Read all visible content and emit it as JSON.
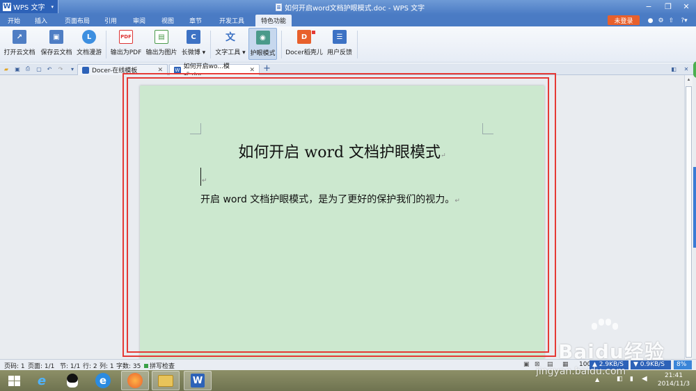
{
  "app": {
    "name": "WPS 文字",
    "window_title": "如何开启word文档护眼模式.doc - WPS 文字"
  },
  "menu": {
    "tabs": [
      "开始",
      "插入",
      "页面布局",
      "引用",
      "审阅",
      "视图",
      "章节",
      "开发工具",
      "特色功能"
    ],
    "active_tab": "特色功能",
    "login_label": "未登录"
  },
  "ribbon": {
    "buttons": [
      {
        "label": "打开云文档",
        "icon": "cloud-open-icon"
      },
      {
        "label": "保存云文档",
        "icon": "cloud-save-icon"
      },
      {
        "label": "文档漫游",
        "icon": "roaming-icon"
      },
      {
        "label": "输出为PDF",
        "icon": "pdf-icon"
      },
      {
        "label": "输出为图片",
        "icon": "image-export-icon"
      },
      {
        "label": "长微博",
        "icon": "weibo-icon"
      },
      {
        "label": "文字工具",
        "icon": "text-tools-icon"
      },
      {
        "label": "护眼模式",
        "icon": "eye-protect-icon"
      },
      {
        "label": "Docer稻壳儿",
        "icon": "docer-icon"
      },
      {
        "label": "用户反馈",
        "icon": "feedback-icon"
      }
    ],
    "active_button": "护眼模式"
  },
  "doc_tabs": [
    {
      "label": "Docer-在线模板"
    },
    {
      "label": "如何开启wo...模式.doc"
    }
  ],
  "document": {
    "heading": "如何开启 word 文档护眼模式",
    "body": "开启 word 文档护眼模式，是为了更好的保护我们的视力。",
    "para_mark": "↵",
    "background": "#cce8cf"
  },
  "status": {
    "page_code": "页码: 1",
    "pages": "页面: 1/1",
    "section": "节: 1/1",
    "row": "行: 2",
    "col": "列: 1",
    "word_count": "字数: 35",
    "spell_check": "拼写检查",
    "zoom": "100",
    "net_up": "2.9KB/S",
    "net_down": "0.9KB/S",
    "net_pct": "8%"
  },
  "taskbar": {
    "time": "21:41",
    "date": "2014/11/3"
  },
  "watermark": {
    "brand": "Baidu经验",
    "url": "jingyan.baidu.com"
  },
  "colors": {
    "highlight_box": "#e53935",
    "title_bar": "#4a7bc4",
    "login": "#e8602c"
  }
}
